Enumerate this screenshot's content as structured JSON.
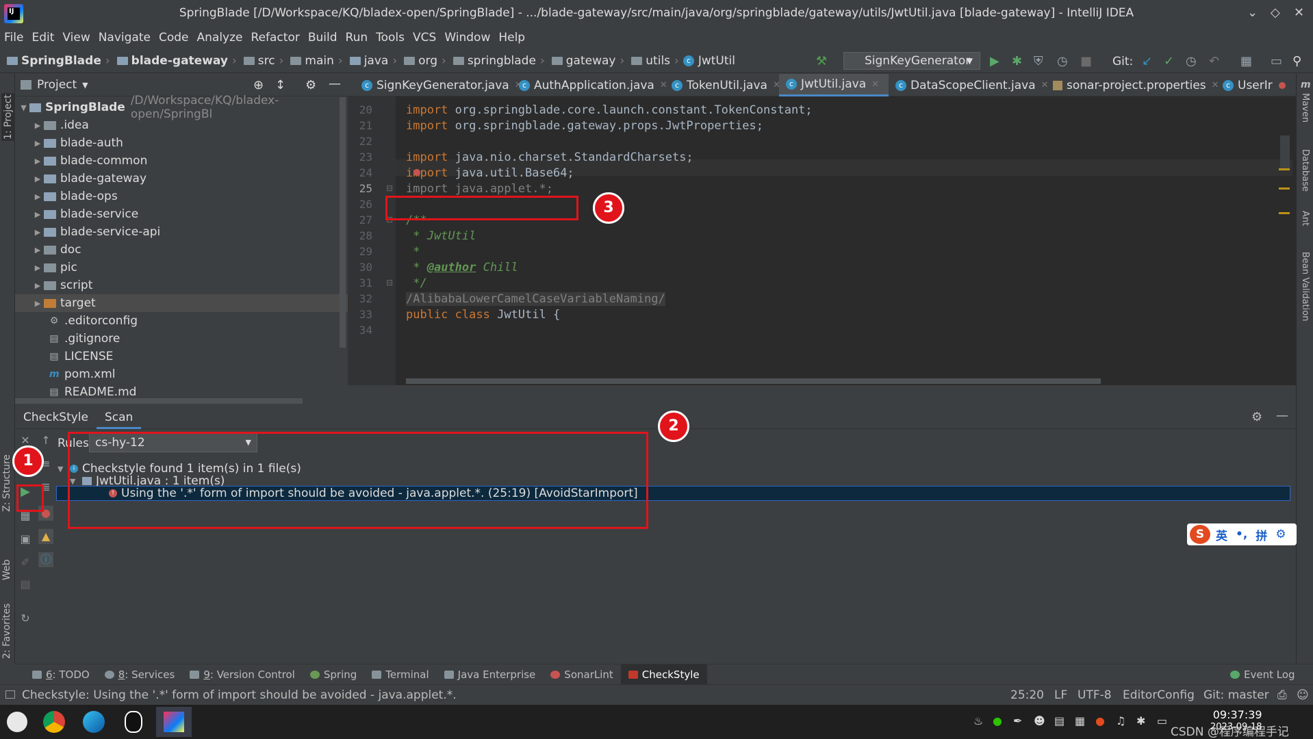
{
  "window": {
    "title": "SpringBlade [/D/Workspace/KQ/bladex-open/SpringBlade] - .../blade-gateway/src/main/java/org/springblade/gateway/utils/JwtUtil.java [blade-gateway] - IntelliJ IDEA"
  },
  "menu": [
    "File",
    "Edit",
    "View",
    "Navigate",
    "Code",
    "Analyze",
    "Refactor",
    "Build",
    "Run",
    "Tools",
    "VCS",
    "Window",
    "Help"
  ],
  "breadcrumbs": [
    "SpringBlade",
    "blade-gateway",
    "src",
    "main",
    "java",
    "org",
    "springblade",
    "gateway",
    "utils",
    "JwtUtil"
  ],
  "toolbar": {
    "run_config": "SignKeyGenerator",
    "git_label": "Git:"
  },
  "left_strip": {
    "project": "1: Project",
    "structure": "Z: Structure",
    "web": "Web",
    "favorites": "2: Favorites"
  },
  "right_strip": {
    "maven": "Maven",
    "database": "Database",
    "ant": "Ant",
    "bean_validation": "Bean Validation"
  },
  "project": {
    "header": "Project",
    "root_name": "SpringBlade",
    "root_path": "/D/Workspace/KQ/bladex-open/SpringBl",
    "items": [
      ".idea",
      "blade-auth",
      "blade-common",
      "blade-gateway",
      "blade-ops",
      "blade-service",
      "blade-service-api",
      "doc",
      "pic",
      "script",
      "target",
      ".editorconfig",
      ".gitignore",
      "LICENSE",
      "pom.xml",
      "README.md"
    ]
  },
  "tabs": [
    "SignKeyGenerator.java",
    "AuthApplication.java",
    "TokenUtil.java",
    "JwtUtil.java",
    "DataScopeClient.java",
    "sonar-project.properties",
    "UserIr"
  ],
  "editor": {
    "line_numbers": [
      "20",
      "21",
      "22",
      "23",
      "24",
      "25",
      "26",
      "27",
      "28",
      "29",
      "30",
      "31",
      "32",
      "33",
      "34"
    ],
    "lines": {
      "l20": "org.springblade.core.launch.constant.TokenConstant;",
      "l21": "org.springblade.gateway.props.JwtProperties;",
      "l23": "java.nio.charset.StandardCharsets;",
      "l24": "java.util.Base64;",
      "l25": "import java.applet.*;",
      "l27": "/**",
      "l28": " * JwtUtil",
      "l29": " *",
      "l30a": " * ",
      "l30tag": "@author",
      "l30b": " Chill",
      "l31": " */",
      "l32": "/AlibabaLowerCamelCaseVariableNaming/",
      "l33cls": " JwtUtil {"
    },
    "kw_import": "import",
    "kw_public": "public",
    "kw_class": "class"
  },
  "annotations": {
    "one": "1",
    "two": "2",
    "three": "3"
  },
  "checkstyle": {
    "tabs": [
      "CheckStyle",
      "Scan"
    ],
    "rules_label": "Rules:",
    "rules_value": "cs-hy-12",
    "summary": "Checkstyle found 1 item(s) in 1 file(s)",
    "file": "JwtUtil.java : 1 item(s)",
    "issue": "Using the '.*' form of import should be avoided - java.applet.*. (25:19) [AvoidStarImport]"
  },
  "ime": {
    "lang": "英",
    "punct": "•,",
    "mode": "拼"
  },
  "tool_tabs": [
    {
      "num": "6",
      "label": ": TODO"
    },
    {
      "num": "8",
      "label": ": Services"
    },
    {
      "num": "9",
      "label": ": Version Control"
    },
    {
      "num": "",
      "label": "Spring"
    },
    {
      "num": "",
      "label": "Terminal"
    },
    {
      "num": "",
      "label": "Java Enterprise"
    },
    {
      "num": "",
      "label": "SonarLint"
    },
    {
      "num": "",
      "label": "CheckStyle"
    }
  ],
  "event_log": "Event Log",
  "status": {
    "message": "Checkstyle: Using the '.*' form of import should be avoided - java.applet.*.",
    "position": "25:20",
    "line_sep": "LF",
    "encoding": "UTF-8",
    "editor_config": "EditorConfig",
    "git_branch": "Git: master"
  },
  "taskbar": {
    "time": "09:37:39",
    "date": "2023-09-18",
    "watermark": "CSDN @程序编程手记"
  },
  "colors": {
    "accent": "#4a88c7",
    "error": "#c75450",
    "annotation_red": "#e1141b",
    "keyword": "#cc7832",
    "comment": "#629755"
  }
}
